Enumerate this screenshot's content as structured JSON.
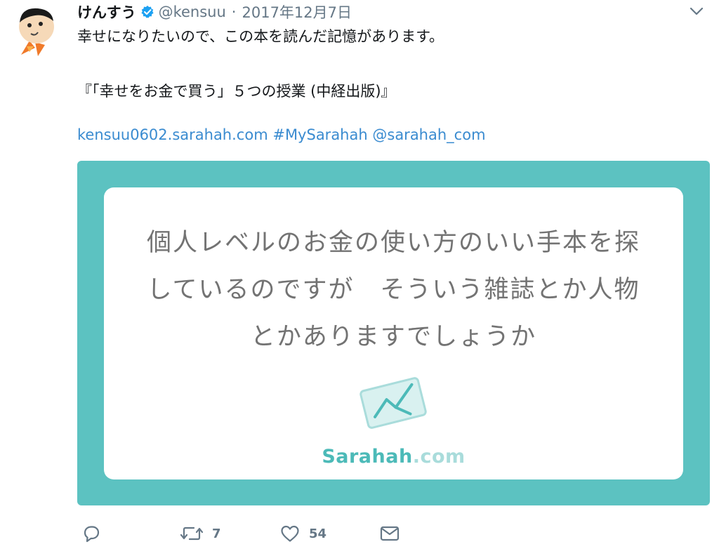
{
  "tweet": {
    "display_name": "けんすう",
    "handle": "@kensuu",
    "separator": "·",
    "date": "2017年12月7日",
    "text_line1": "幸せになりたいので、この本を読んだ記憶があります。",
    "text_line2": "『「幸せをお金で買う」５つの授業 (中経出版)』",
    "link_url": "kensuu0602.sarahah.com",
    "hashtag": "#MySarahah",
    "mention": "@sarahah_com"
  },
  "card": {
    "question_lines": [
      "個人レベルのお金の使い方のいい手本を探",
      "しているのですが　そういう雑誌とか人物",
      "とかありますでしょうか"
    ],
    "brand_name": "Sarahah",
    "brand_suffix": ".com"
  },
  "actions": {
    "reply_count": "",
    "retweet_count": "7",
    "like_count": "54"
  },
  "icons": {
    "avatar": "avatar-image",
    "verified": "verified-badge-icon",
    "menu": "chevron-down-icon",
    "reply": "reply-icon",
    "retweet": "retweet-icon",
    "like": "heart-icon",
    "dm": "envelope-icon"
  },
  "colors": {
    "accent": "#3a8bd0",
    "card_bg": "#5cc2c1",
    "brand": "#4cbab8",
    "muted": "#657786"
  }
}
